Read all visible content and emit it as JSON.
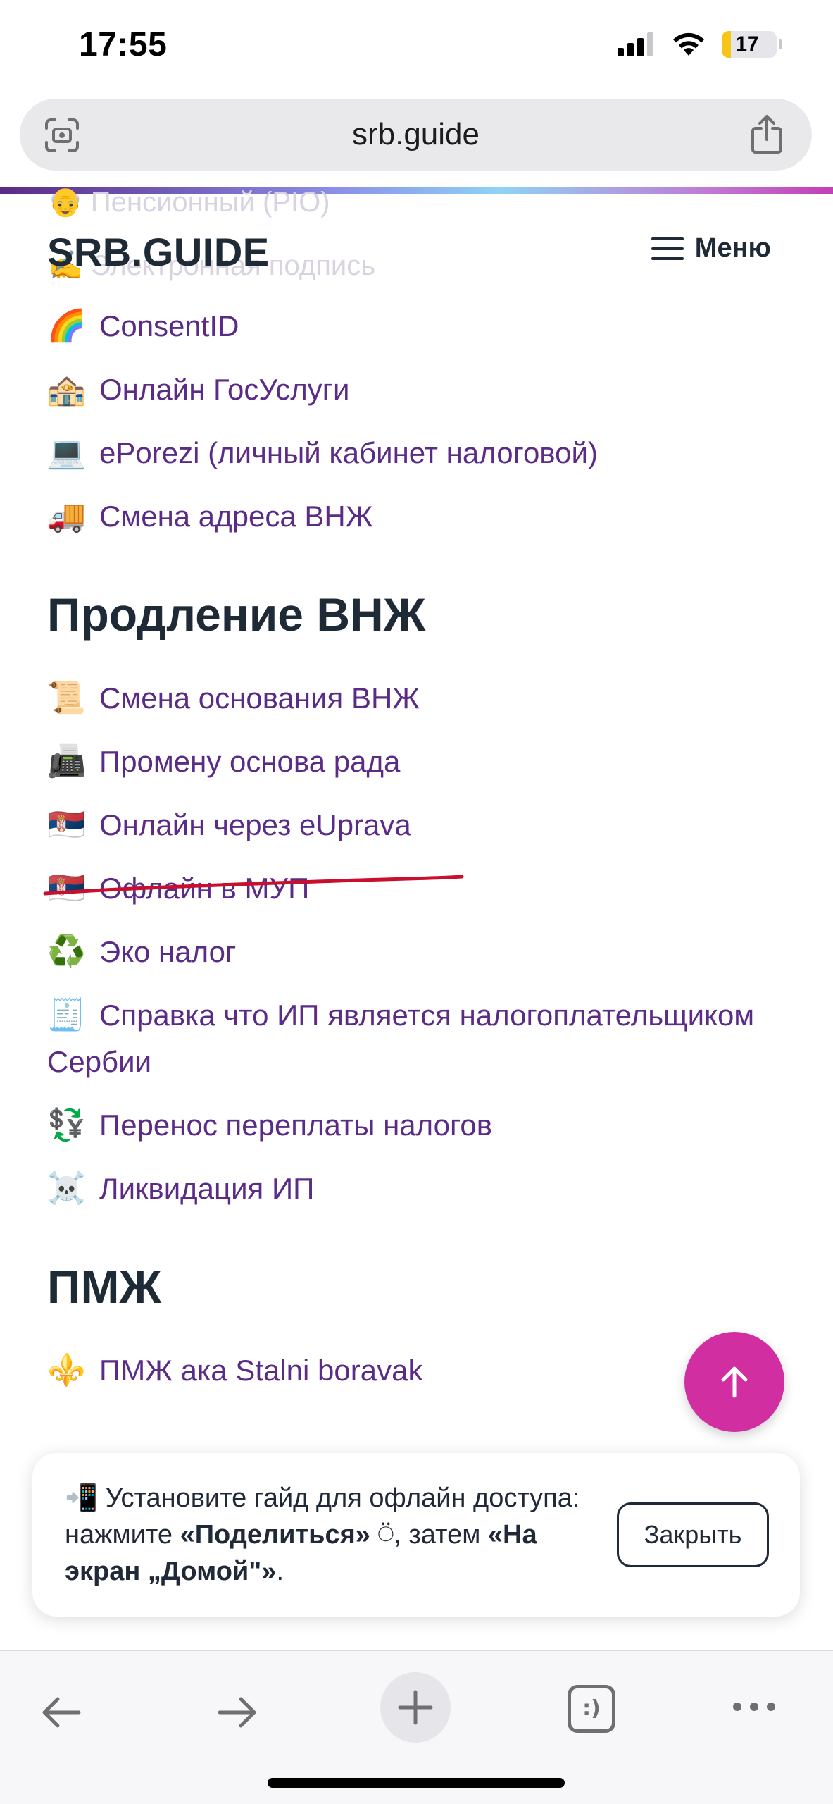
{
  "status_bar": {
    "time": "17:55",
    "battery_level": "17",
    "battery_fraction": 0.17,
    "battery_color": "#f5c518",
    "icons": [
      "signal-icon",
      "wifi-icon",
      "battery-icon"
    ]
  },
  "browser": {
    "url": "srb.guide",
    "left_icon": "page-scan-icon",
    "right_icon": "share-icon"
  },
  "site": {
    "logo": "SRB.GUIDE",
    "menu_label": "Меню",
    "ghost_rows": [
      "👴 Пенсионный (PIO)",
      "✍️ Электронная подпись"
    ]
  },
  "sections": [
    {
      "title": "",
      "items": [
        {
          "emoji": "🌈",
          "label": "ConsentID"
        },
        {
          "emoji": "🏤",
          "label": "Онлайн ГосУслуги"
        },
        {
          "emoji": "💻",
          "label": "ePorezi (личный кабинет налоговой)"
        },
        {
          "emoji": "🚚",
          "label": "Смена адреса ВНЖ"
        }
      ]
    },
    {
      "title": "Продление ВНЖ",
      "items": [
        {
          "emoji": "📜",
          "label": "Смена основания ВНЖ"
        },
        {
          "emoji": "📠",
          "label": "Промену основа рада"
        },
        {
          "emoji": "🇷🇸",
          "label": "Онлайн через eUprava"
        },
        {
          "emoji": "🇷🇸",
          "label": "Офлайн в МУП"
        },
        {
          "emoji": "♻️",
          "label": "Эко налог"
        },
        {
          "emoji": "🧾",
          "label": "Справка что ИП является налогоплательщиком Сербии"
        },
        {
          "emoji": "💱",
          "label": "Перенос переплаты налогов"
        },
        {
          "emoji": "☠️",
          "label": "Ликвидация ИП"
        }
      ]
    },
    {
      "title": "ПМЖ",
      "items": [
        {
          "emoji": "⚜️",
          "label": "ПМЖ ака Stalni boravak"
        }
      ]
    }
  ],
  "banner": {
    "emoji": "📲",
    "text_1": " Установите гайд для офлайн доступа: нажмите ",
    "bold_1": "«Поделиться»",
    "text_2": " ⍥, затем ",
    "bold_2": "«На экран „Домой\"»",
    "text_3": ".",
    "close_label": "Закрыть"
  },
  "toolbar": {
    "icons": [
      "back-arrow-icon",
      "forward-arrow-icon",
      "new-tab-plus-icon",
      "tabs-icon",
      "more-dots-icon"
    ],
    "tabs_glyph": ":)"
  },
  "colors": {
    "link": "#5b2c87",
    "fab": "#d02ea1",
    "annotation": "#c8102e"
  }
}
